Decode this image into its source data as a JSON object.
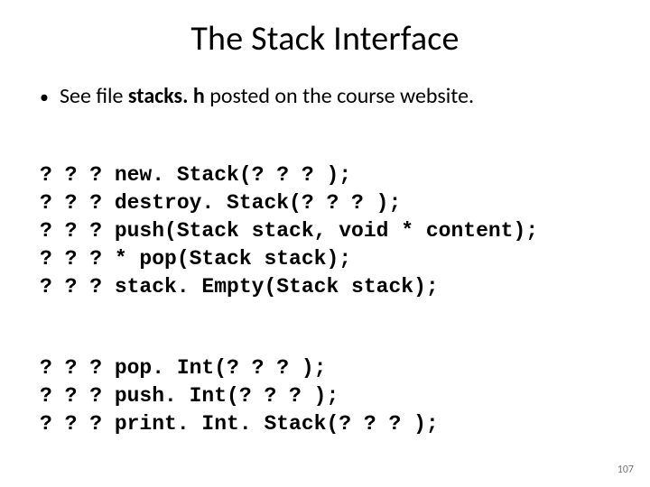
{
  "title": "The Stack Interface",
  "bullet": {
    "prefix": "See file ",
    "bold": "stacks. h",
    "suffix": " posted on the course website."
  },
  "code": {
    "block1": [
      "? ? ? new. Stack(? ? ? );",
      "? ? ? destroy. Stack(? ? ? );",
      "? ? ? push(Stack stack, void * content);",
      "? ? ? * pop(Stack stack);",
      "? ? ? stack. Empty(Stack stack);"
    ],
    "block2": [
      "? ? ? pop. Int(? ? ? );",
      "? ? ? push. Int(? ? ? );",
      "? ? ? print. Int. Stack(? ? ? );"
    ]
  },
  "pageNumber": "107"
}
